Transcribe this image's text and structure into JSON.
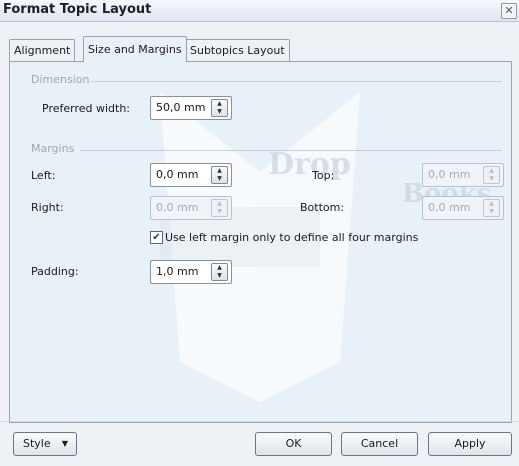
{
  "window": {
    "title": "Format Topic Layout",
    "close_label": "✕"
  },
  "tabs": [
    {
      "label": "Alignment",
      "active": false
    },
    {
      "label": "Size and Margins",
      "active": true
    },
    {
      "label": "Subtopics Layout",
      "active": false
    }
  ],
  "dimension": {
    "section_label": "Dimension",
    "preferred_width_label": "Preferred width:",
    "preferred_width_value": "50,0 mm"
  },
  "margins": {
    "section_label": "Margins",
    "left_label": "Left:",
    "left_value": "0,0 mm",
    "right_label": "Right:",
    "right_value": "0,0 mm",
    "top_label": "Top:",
    "top_value": "0,0 mm",
    "bottom_label": "Bottom:",
    "bottom_value": "0,0 mm",
    "use_left_label": "Use left margin only to define all four margins",
    "use_left_checked": true
  },
  "padding": {
    "label": "Padding:",
    "value": "1,0 mm"
  },
  "footer": {
    "style_label": "Style",
    "ok_label": "OK",
    "cancel_label": "Cancel",
    "apply_label": "Apply"
  },
  "colors": {
    "panel_bg": "#e9f1f8",
    "border": "#98a4b6",
    "disabled_text": "#9aa3ae"
  }
}
